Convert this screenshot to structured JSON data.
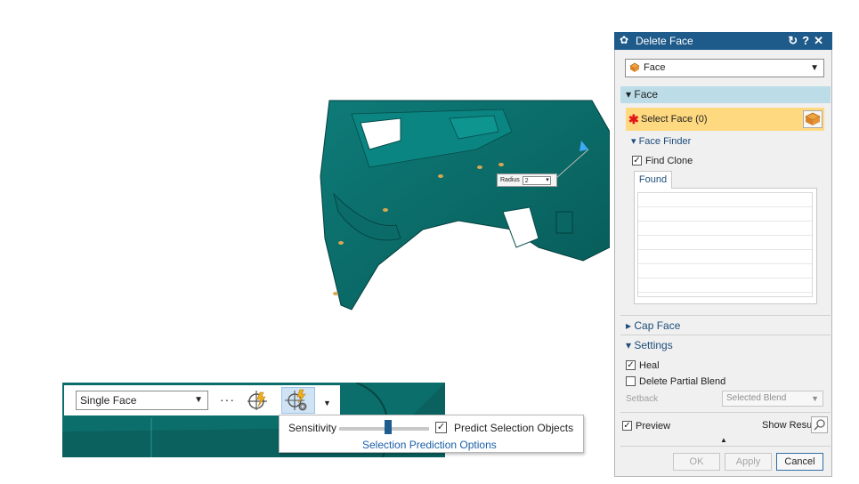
{
  "model": {
    "radius_label": "Radius",
    "radius_value": "2"
  },
  "toolbar": {
    "filter_value": "Single Face",
    "more_label": "···",
    "sensitivity_label": "Sensitivity",
    "sensitivity_level": 0.55,
    "predict_label": "Predict Selection Objects",
    "predict_checked": true,
    "options_link": "Selection Prediction Options"
  },
  "dialog": {
    "title": "Delete Face",
    "type_value": "Face",
    "sections": {
      "face": "Face",
      "select_face": "Select Face (0)",
      "face_finder": "Face Finder",
      "find_clone": "Find Clone",
      "found_tab": "Found",
      "cap_face": "Cap Face",
      "settings": "Settings",
      "heal": "Heal",
      "delete_partial_blend": "Delete Partial Blend",
      "setback_label": "Setback",
      "setback_value": "Selected Blend",
      "preview": "Preview",
      "show_result": "Show Result"
    },
    "buttons": {
      "ok": "OK",
      "apply": "Apply",
      "cancel": "Cancel"
    }
  },
  "colors": {
    "model_teal": "#0f6f6c",
    "title_bar": "#1e5a8a",
    "selection_row": "#ffd980",
    "section_header": "#bcdde8"
  }
}
